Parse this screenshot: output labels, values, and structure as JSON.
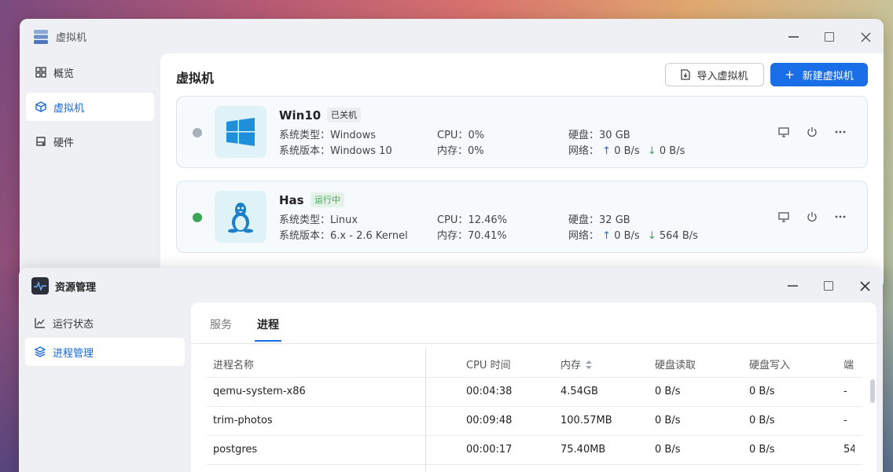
{
  "vm_window": {
    "title": "虚拟机",
    "sidebar": [
      {
        "label": "概览",
        "icon": "grid-icon",
        "active": false
      },
      {
        "label": "虚拟机",
        "icon": "cube-icon",
        "active": true
      },
      {
        "label": "硬件",
        "icon": "drive-icon",
        "active": false
      }
    ],
    "page_title": "虚拟机",
    "import_label": "导入虚拟机",
    "new_label": "新建虚拟机",
    "new_prefix": "+",
    "vms": [
      {
        "name": "Win10",
        "status": "已关机",
        "status_color": "#a7b0bd",
        "os_type_label": "系统类型：",
        "os_type": "Windows",
        "os_ver_label": "系统版本：",
        "os_ver": "Windows 10",
        "cpu_label": "CPU：",
        "cpu": "0%",
        "mem_label": "内存：",
        "mem": "0%",
        "disk_label": "硬盘：",
        "disk": "30 GB",
        "net_label": "网络：",
        "net_up": "0 B/s",
        "net_down": "0 B/s"
      },
      {
        "name": "Has",
        "status": "运行中",
        "status_color": "#3aa757",
        "os_type_label": "系统类型：",
        "os_type": "Linux",
        "os_ver_label": "系统版本：",
        "os_ver": "6.x - 2.6 Kernel",
        "cpu_label": "CPU：",
        "cpu": "12.46%",
        "mem_label": "内存：",
        "mem": "70.41%",
        "disk_label": "硬盘：",
        "disk": "32 GB",
        "net_label": "网络：",
        "net_up": "0 B/s",
        "net_down": "564 B/s"
      }
    ]
  },
  "res_window": {
    "title": "资源管理",
    "sidebar": [
      {
        "label": "运行状态",
        "icon": "line-chart-icon",
        "active": false
      },
      {
        "label": "进程管理",
        "icon": "layers-icon",
        "active": true
      }
    ],
    "tabs": [
      {
        "label": "服务",
        "active": false
      },
      {
        "label": "进程",
        "active": true
      }
    ],
    "columns": [
      "进程名称",
      "CPU 时间",
      "内存",
      "硬盘读取",
      "硬盘写入",
      "端"
    ],
    "rows": [
      {
        "name": "qemu-system-x86",
        "cpu_time": "00:04:38",
        "mem": "4.54GB",
        "read": "0 B/s",
        "write": "0 B/s",
        "extra": "-"
      },
      {
        "name": "trim-photos",
        "cpu_time": "00:09:48",
        "mem": "100.57MB",
        "read": "0 B/s",
        "write": "0 B/s",
        "extra": "-"
      },
      {
        "name": "postgres",
        "cpu_time": "00:00:17",
        "mem": "75.40MB",
        "read": "0 B/s",
        "write": "0 B/s",
        "extra": "54"
      }
    ]
  }
}
